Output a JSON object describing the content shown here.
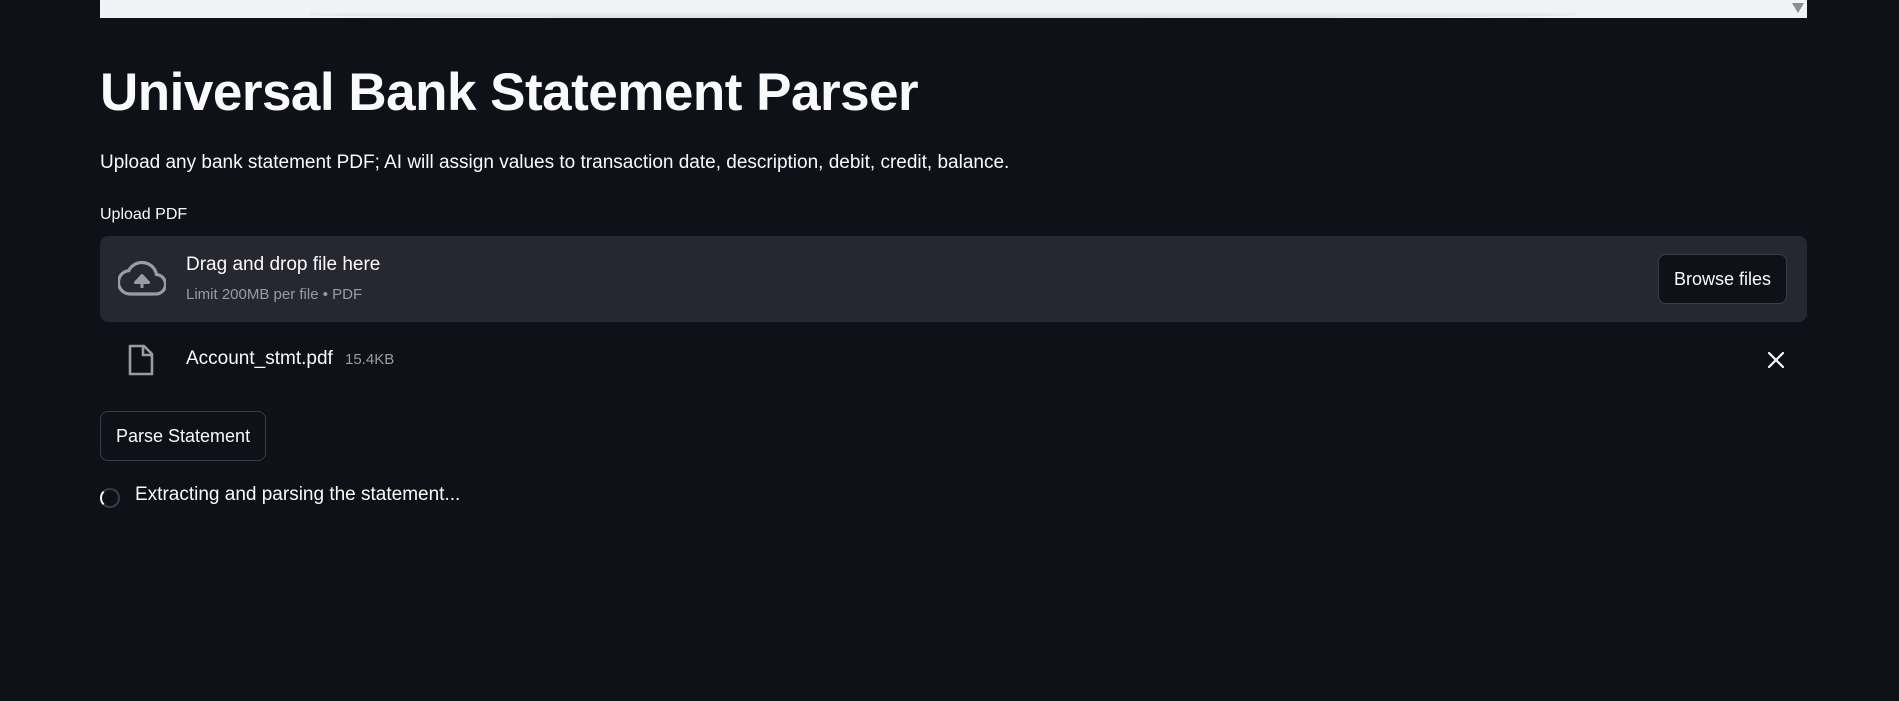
{
  "header": {
    "title": "Universal Bank Statement Parser",
    "subtitle": "Upload any bank statement PDF; AI will assign values to transaction date, description, debit, credit, balance."
  },
  "uploader": {
    "label": "Upload PDF",
    "drop_title": "Drag and drop file here",
    "drop_limit": "Limit 200MB per file • PDF",
    "browse_label": "Browse files",
    "icon": "cloud-upload-icon"
  },
  "uploaded_file": {
    "name": "Account_stmt.pdf",
    "size": "15.4KB",
    "icon": "file-icon",
    "remove_icon": "close-icon"
  },
  "actions": {
    "parse_label": "Parse Statement"
  },
  "status": {
    "text": "Extracting and parsing the statement..."
  },
  "colors": {
    "background": "#0e1117",
    "dropzone": "#262730",
    "text": "#fafafa",
    "muted_text": "#9a9ba3",
    "border": "#3b3d46"
  }
}
